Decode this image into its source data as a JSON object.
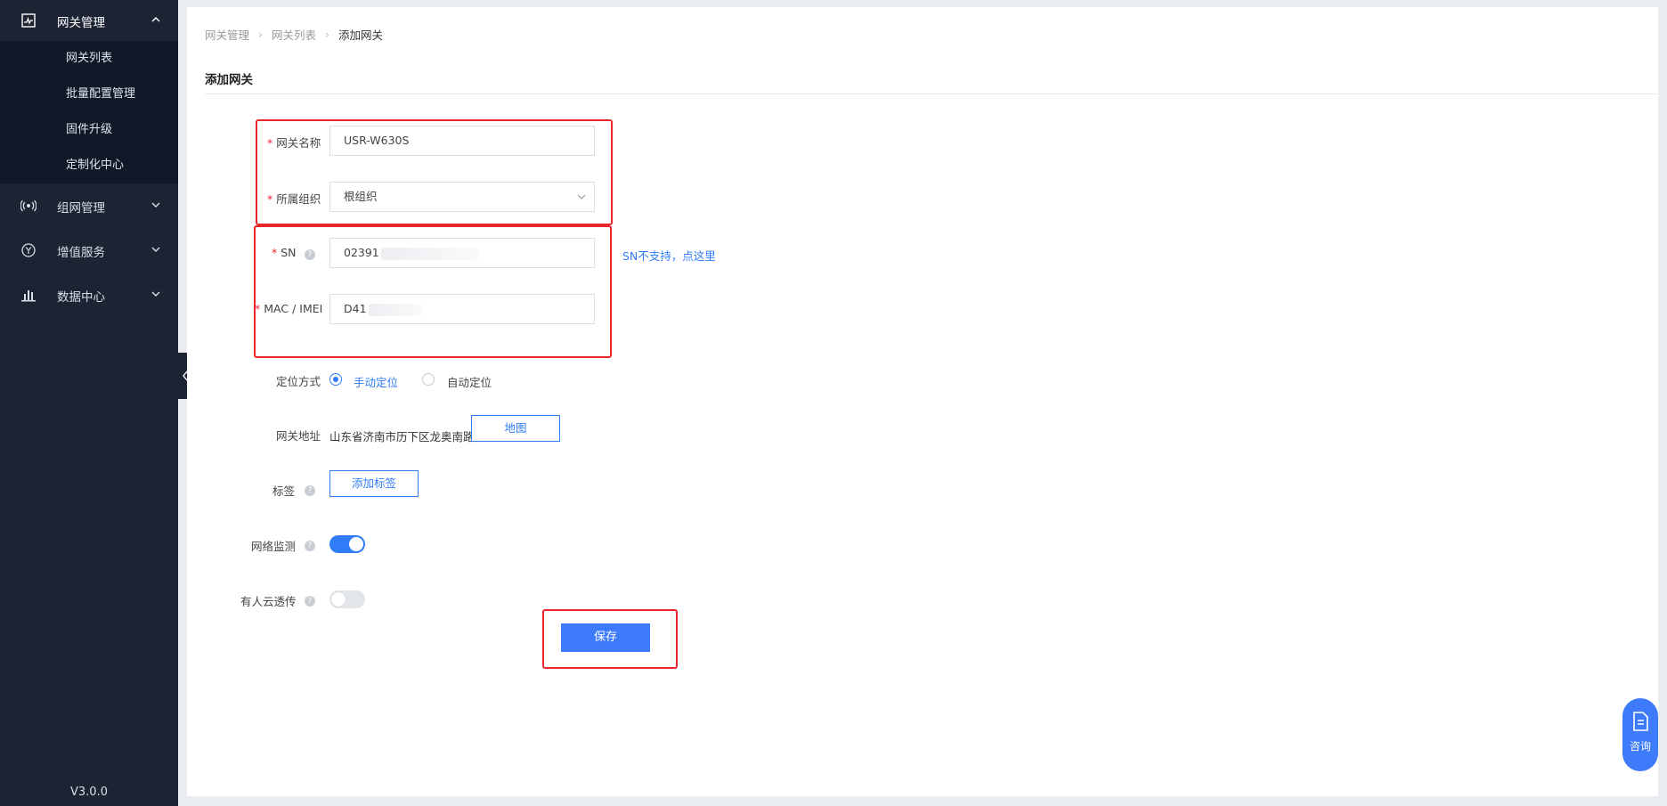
{
  "sidebar": {
    "top_item": {
      "label": "网关管理",
      "icon": "gateway-monitor-icon"
    },
    "sub_items": [
      "网关列表",
      "批量配置管理",
      "固件升级",
      "定制化中心"
    ],
    "items": [
      {
        "label": "组网管理",
        "icon": "wireless-network-icon"
      },
      {
        "label": "增值服务",
        "icon": "yuan-coin-icon"
      },
      {
        "label": "数据中心",
        "icon": "bar-chart-icon"
      }
    ],
    "version": "V3.0.0"
  },
  "breadcrumb": [
    "网关管理",
    "网关列表",
    "添加网关"
  ],
  "page_title": "添加网关",
  "form": {
    "name": {
      "label": "网关名称",
      "value": "USR-W630S"
    },
    "org": {
      "label": "所属组织",
      "value": "根组织"
    },
    "sn": {
      "label": "SN",
      "value": "02391",
      "link": "SN不支持，点这里"
    },
    "mac": {
      "label": "MAC / IMEI",
      "value": "D41"
    },
    "locate": {
      "label": "定位方式",
      "options": [
        "手动定位",
        "自动定位"
      ],
      "selected": "手动定位"
    },
    "address": {
      "label": "网关地址",
      "value": "山东省济南市历下区龙奥南路",
      "button": "地图"
    },
    "tags": {
      "label": "标签",
      "button": "添加标签"
    },
    "monitor": {
      "label": "网络监测",
      "on": true
    },
    "cloud": {
      "label": "有人云透传",
      "on": false
    }
  },
  "save_label": "保存",
  "consult_label": "咨询",
  "colors": {
    "accent": "#3d7bfa",
    "sidebar_bg": "#1c2433",
    "highlight": "#e8262b"
  }
}
